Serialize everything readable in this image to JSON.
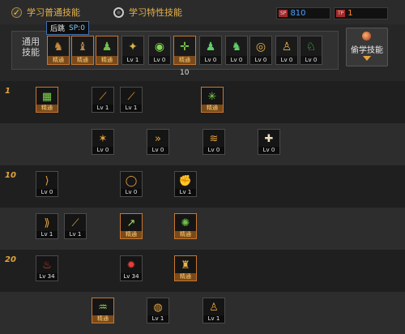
{
  "header": {
    "radio_normal": {
      "label": "学习普通技能",
      "selected": true
    },
    "radio_special": {
      "label": "学习特性技能",
      "selected": false
    },
    "sp_points": {
      "tag": "SP",
      "value": "810"
    },
    "tp_points": {
      "tag": "TP",
      "value": "1"
    }
  },
  "common": {
    "label": "通用\n技能",
    "tooltip": {
      "name": "后跳",
      "sp": "SP:0"
    },
    "count": "10",
    "slots": [
      {
        "caption": "精通",
        "mastered": true,
        "icon": "backflip-icon",
        "glyph": "♞",
        "color": "#c98a3a"
      },
      {
        "caption": "精通",
        "mastered": true,
        "icon": "throw-icon",
        "glyph": "♝",
        "color": "#b58a4a"
      },
      {
        "caption": "精通",
        "mastered": true,
        "icon": "kick-icon",
        "glyph": "♟",
        "color": "#6fbf4a"
      },
      {
        "caption": "Lv 1",
        "mastered": false,
        "icon": "wings-icon",
        "glyph": "✦",
        "color": "#d8b24a"
      },
      {
        "caption": "Lv 0",
        "mastered": false,
        "icon": "target-icon",
        "glyph": "◉",
        "color": "#7fd84a"
      },
      {
        "caption": "精通",
        "mastered": true,
        "icon": "crosshair-icon",
        "glyph": "✛",
        "color": "#7fd84a"
      },
      {
        "caption": "Lv 0",
        "mastered": false,
        "icon": "runner-icon",
        "glyph": "♟",
        "color": "#5fcf6a"
      },
      {
        "caption": "Lv 0",
        "mastered": false,
        "icon": "dash-icon",
        "glyph": "♞",
        "color": "#5fcf6a"
      },
      {
        "caption": "Lv 0",
        "mastered": false,
        "icon": "eye-icon",
        "glyph": "◎",
        "color": "#e6b24a"
      },
      {
        "caption": "Lv 0",
        "mastered": false,
        "icon": "figure-icon",
        "glyph": "♙",
        "color": "#e6b24a"
      },
      {
        "caption": "Lv 0",
        "mastered": false,
        "icon": "leap-icon",
        "glyph": "♘",
        "color": "#5fcf6a"
      }
    ]
  },
  "dual_button": {
    "label": "偷学技能",
    "icon": "orb-icon"
  },
  "tree": {
    "levels": [
      {
        "label": "1"
      },
      {
        "label": ""
      },
      {
        "label": "10"
      },
      {
        "label": ""
      },
      {
        "label": "20"
      },
      {
        "label": ""
      }
    ],
    "rows": [
      [
        {
          "caption": "精通",
          "mastered": true,
          "icon": "arena-icon",
          "glyph": "▦",
          "color": "#7fd84a"
        },
        {
          "caption": "Lv 1",
          "mastered": false,
          "icon": "slash-icon",
          "glyph": "⟋",
          "color": "#e6a23a"
        },
        {
          "caption": "Lv 1",
          "mastered": false,
          "icon": "claw-icon",
          "glyph": "⟋",
          "color": "#e6a23a"
        },
        {
          "caption": "精通",
          "mastered": true,
          "icon": "spark-icon",
          "glyph": "✳",
          "color": "#7fd84a"
        }
      ],
      [
        {
          "caption": "Lv 0",
          "mastered": false,
          "icon": "burst-icon",
          "glyph": "✶",
          "color": "#e6a23a"
        },
        {
          "caption": "Lv 0",
          "mastered": false,
          "icon": "arrows-icon",
          "glyph": "»",
          "color": "#e6a23a"
        },
        {
          "caption": "Lv 0",
          "mastered": false,
          "icon": "wave-icon",
          "glyph": "≋",
          "color": "#e6a23a"
        },
        {
          "caption": "Lv 0",
          "mastered": false,
          "icon": "shield-icon",
          "glyph": "✚",
          "color": "#f0e0c0"
        }
      ],
      [
        {
          "caption": "Lv 0",
          "mastered": false,
          "icon": "swipe-icon",
          "glyph": "⟩",
          "color": "#e6a23a"
        },
        {
          "caption": "Lv 0",
          "mastered": false,
          "icon": "ring-icon",
          "glyph": "◯",
          "color": "#e6a23a"
        },
        {
          "caption": "Lv 1",
          "mastered": false,
          "icon": "fist-icon",
          "glyph": "✊",
          "color": "#e6a23a"
        }
      ],
      [
        {
          "caption": "Lv 1",
          "mastered": false,
          "icon": "combo-icon",
          "glyph": "⟫",
          "color": "#e6a23a"
        },
        {
          "caption": "Lv 1",
          "mastered": false,
          "icon": "streak-icon",
          "glyph": "⟋",
          "color": "#e6a23a"
        },
        {
          "caption": "精通",
          "mastered": true,
          "icon": "uppercut-icon",
          "glyph": "↗",
          "color": "#a8e05a"
        },
        {
          "caption": "精通",
          "mastered": true,
          "icon": "net-icon",
          "glyph": "✺",
          "color": "#6fbf4a"
        }
      ],
      [
        {
          "caption": "Lv 34",
          "mastered": false,
          "icon": "flame-icon",
          "glyph": "♨",
          "color": "#e0403a"
        },
        {
          "caption": "Lv 34",
          "mastered": false,
          "icon": "vortex-icon",
          "glyph": "✹",
          "color": "#e0403a"
        },
        {
          "caption": "精通",
          "mastered": true,
          "icon": "bell-icon",
          "glyph": "♜",
          "color": "#e6b24a"
        }
      ],
      [
        {
          "caption": "精通",
          "mastered": true,
          "icon": "swing-icon",
          "glyph": "♒",
          "color": "#9ad84a"
        },
        {
          "caption": "Lv 1",
          "mastered": false,
          "icon": "orbit-icon",
          "glyph": "◍",
          "color": "#e6a23a"
        },
        {
          "caption": "Lv 1",
          "mastered": false,
          "icon": "pose-icon",
          "glyph": "♙",
          "color": "#e6a23a"
        }
      ]
    ]
  }
}
